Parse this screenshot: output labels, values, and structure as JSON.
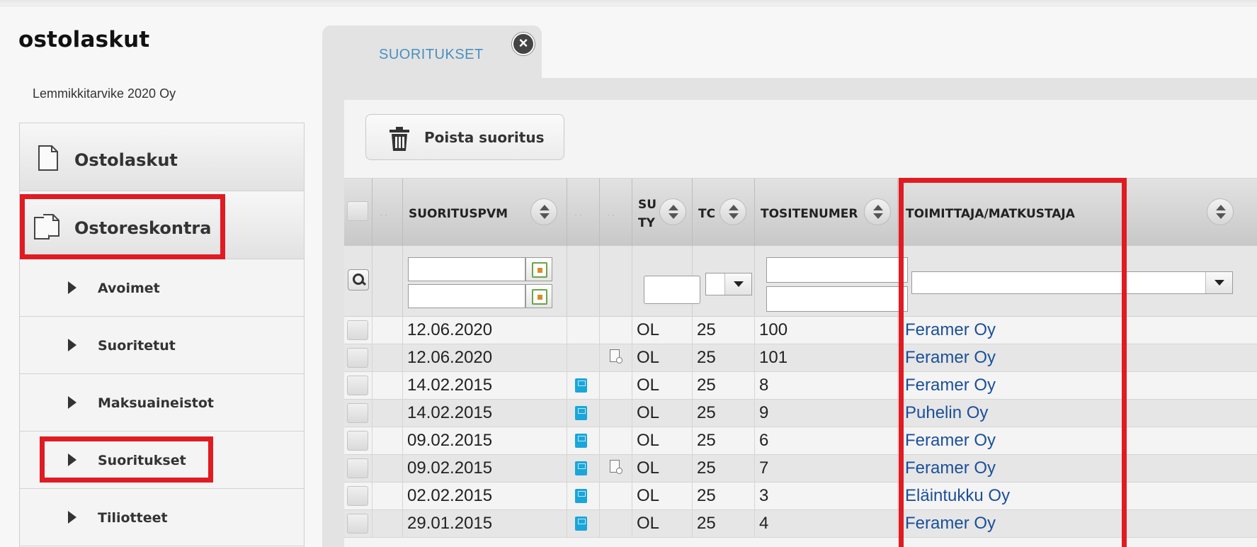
{
  "app": {
    "title": "ostolaskut",
    "company": "Lemmikkitarvike 2020 Oy"
  },
  "nav": {
    "top": [
      {
        "label": "Ostolaskut",
        "icon": "document-icon"
      },
      {
        "label": "Ostoreskontra",
        "icon": "documents-icon"
      }
    ],
    "items": [
      {
        "label": "Avoimet"
      },
      {
        "label": "Suoritetut"
      },
      {
        "label": "Maksuaineistot"
      },
      {
        "label": "Suoritukset"
      },
      {
        "label": "Tiliotteet"
      }
    ]
  },
  "tab": {
    "label": "SUORITUKSET",
    "close": "×"
  },
  "toolbar": {
    "delete_label": "Poista suoritus"
  },
  "grid": {
    "headers": {
      "date": "SUORITUSPVM",
      "type": "SU TY",
      "tc": "TC",
      "voucher": "TOSITENUMER",
      "supplier": "TOIMITTAJA/MATKUSTAJA"
    },
    "rows": [
      {
        "date": "12.06.2020",
        "book": false,
        "doc": false,
        "type": "OL",
        "tc": "25",
        "voucher": "100",
        "supplier": "Feramer Oy"
      },
      {
        "date": "12.06.2020",
        "book": false,
        "doc": true,
        "type": "OL",
        "tc": "25",
        "voucher": "101",
        "supplier": "Feramer Oy"
      },
      {
        "date": "14.02.2015",
        "book": true,
        "doc": false,
        "type": "OL",
        "tc": "25",
        "voucher": "8",
        "supplier": "Feramer Oy"
      },
      {
        "date": "14.02.2015",
        "book": true,
        "doc": false,
        "type": "OL",
        "tc": "25",
        "voucher": "9",
        "supplier": "Puhelin Oy"
      },
      {
        "date": "09.02.2015",
        "book": true,
        "doc": false,
        "type": "OL",
        "tc": "25",
        "voucher": "6",
        "supplier": "Feramer Oy"
      },
      {
        "date": "09.02.2015",
        "book": true,
        "doc": true,
        "type": "OL",
        "tc": "25",
        "voucher": "7",
        "supplier": "Feramer Oy"
      },
      {
        "date": "02.02.2015",
        "book": true,
        "doc": false,
        "type": "OL",
        "tc": "25",
        "voucher": "3",
        "supplier": "Eläintukku Oy"
      },
      {
        "date": "29.01.2015",
        "book": true,
        "doc": false,
        "type": "OL",
        "tc": "25",
        "voucher": "4",
        "supplier": "Feramer Oy"
      }
    ]
  },
  "colors": {
    "highlight": "#e01b22",
    "link": "#1b4f9a",
    "tab_text": "#4a8fbf",
    "book_icon": "#1aa6d9"
  }
}
